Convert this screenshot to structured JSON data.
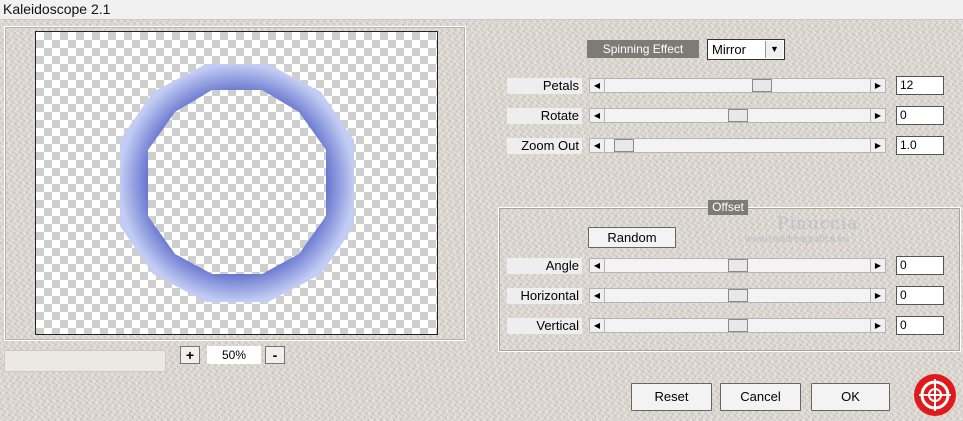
{
  "window": {
    "title": "Kaleidoscope 2.1"
  },
  "preview": {
    "zoom_value": "50%",
    "zoom_in_label": "+",
    "zoom_out_label": "-"
  },
  "spinning": {
    "label": "Spinning Effect",
    "selected": "Mirror"
  },
  "sliders": [
    {
      "label": "Petals",
      "value": "12",
      "fraction": 0.6
    },
    {
      "label": "Rotate",
      "value": "0",
      "fraction": 0.5
    },
    {
      "label": "Zoom Out",
      "value": "1.0",
      "fraction": 0.04
    }
  ],
  "offset": {
    "title": "Offset",
    "random_label": "Random",
    "sliders": [
      {
        "label": "Angle",
        "value": "0",
        "fraction": 0.5
      },
      {
        "label": "Horizontal",
        "value": "0",
        "fraction": 0.5
      },
      {
        "label": "Vertical",
        "value": "0",
        "fraction": 0.5
      }
    ]
  },
  "watermark": {
    "name": "Pinuccia",
    "site": "www.moidreagrafica.eu"
  },
  "buttons": {
    "reset": "Reset",
    "cancel": "Cancel",
    "ok": "OK"
  },
  "colors": {
    "ring_outer": "#aab6ee",
    "ring_inner": "#2c3a9e",
    "logo": "#e0191c"
  },
  "icons": {
    "left_arrow": "left-arrow-icon",
    "right_arrow": "right-arrow-icon",
    "dropdown": "chevron-down-icon",
    "logo": "lifebuoy-icon"
  }
}
